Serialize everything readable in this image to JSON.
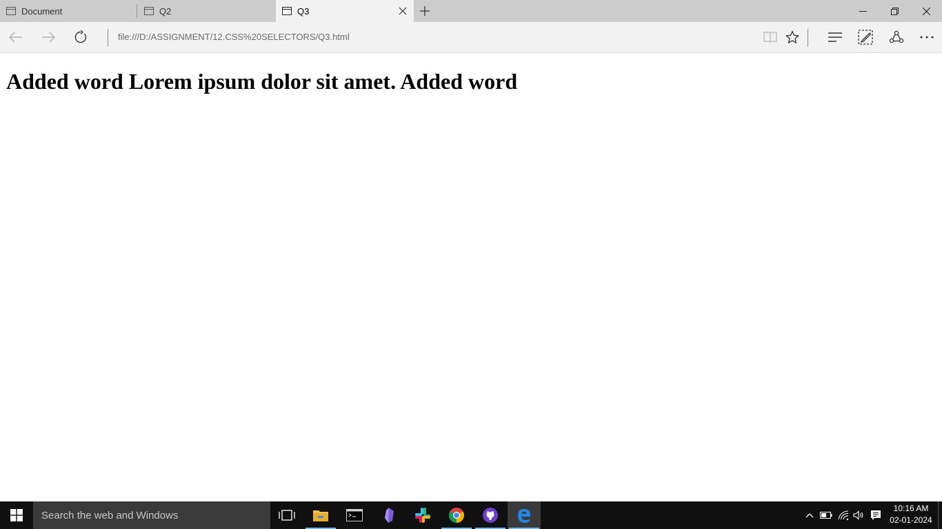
{
  "browser": {
    "tabs": [
      {
        "title": "Document",
        "active": false
      },
      {
        "title": "Q2",
        "active": false
      },
      {
        "title": "Q3",
        "active": true
      }
    ],
    "address": "file:///D:/ASSIGNMENT/12.CSS%20SELECTORS/Q3.html"
  },
  "page": {
    "heading": "Added word Lorem ipsum dolor sit amet. Added word"
  },
  "taskbar": {
    "search_placeholder": "Search the web and Windows",
    "apps": [
      "task-view",
      "file-explorer",
      "command-prompt",
      "obsidian",
      "slack",
      "chrome",
      "github-desktop",
      "edge"
    ],
    "time": "10:16 AM",
    "date": "02-01-2024"
  },
  "colors": {
    "tabstrip": "#cccccc",
    "active_tab": "#f2f2f2",
    "taskbar": "#101010",
    "search_box": "#3b3b3b",
    "running_indicator": "#76b9ed"
  }
}
